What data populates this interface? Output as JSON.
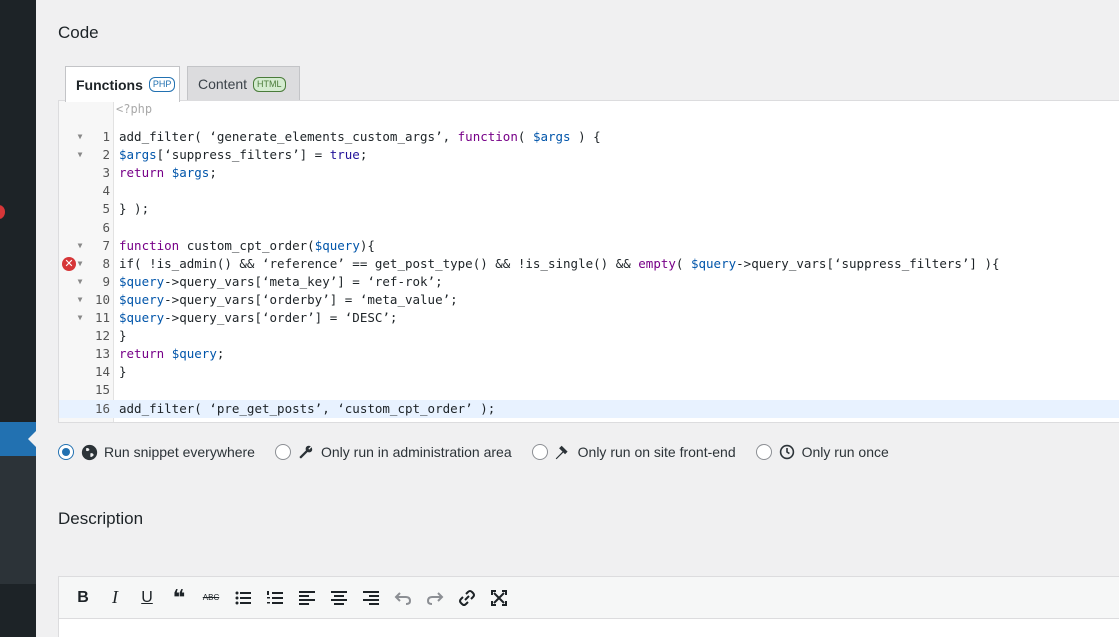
{
  "section_code_title": "Code",
  "tabs": [
    {
      "label": "Functions",
      "badge": "PHP"
    },
    {
      "label": "Content",
      "badge": "HTML"
    }
  ],
  "editor": {
    "php_open_tag": "<?php",
    "lines": [
      {
        "num": "1",
        "text": "add_filter( ‘generate_elements_custom_args’, function( $args ) {"
      },
      {
        "num": "2",
        "text": "$args[‘suppress_filters’] = true;"
      },
      {
        "num": "3",
        "text": "return $args;"
      },
      {
        "num": "4",
        "text": ""
      },
      {
        "num": "5",
        "text": "} );"
      },
      {
        "num": "6",
        "text": ""
      },
      {
        "num": "7",
        "text": "function custom_cpt_order($query){"
      },
      {
        "num": "8",
        "text": "if( !is_admin() && ‘reference’ == get_post_type() && !is_single() && empty( $query->query_vars[‘suppress_filters’] ){"
      },
      {
        "num": "9",
        "text": "$query->query_vars[‘meta_key’] = ‘ref-rok’;"
      },
      {
        "num": "10",
        "text": "$query->query_vars[‘orderby’] = ‘meta_value’;"
      },
      {
        "num": "11",
        "text": "$query->query_vars[‘order’] = ‘DESC’;"
      },
      {
        "num": "12",
        "text": "}"
      },
      {
        "num": "13",
        "text": "return $query;"
      },
      {
        "num": "14",
        "text": "}"
      },
      {
        "num": "15",
        "text": ""
      },
      {
        "num": "16",
        "text": "add_filter( ‘pre_get_posts’, ‘custom_cpt_order’ );"
      }
    ],
    "error_line": "8",
    "active_line": "16"
  },
  "scopes": [
    {
      "label": "Run snippet everywhere",
      "icon": "globe-icon",
      "selected": true
    },
    {
      "label": "Only run in administration area",
      "icon": "wrench-icon",
      "selected": false
    },
    {
      "label": "Only run on site front-end",
      "icon": "hammer-icon",
      "selected": false
    },
    {
      "label": "Only run once",
      "icon": "clock-icon",
      "selected": false
    }
  ],
  "section_description_title": "Description",
  "toolbar": {
    "bold": "B",
    "italic": "I",
    "underline": "U",
    "blockquote": "❝",
    "strikethrough": "ABC"
  },
  "colors": {
    "accent": "#2271b1",
    "error": "#d63638",
    "sidebar": "#1d2327"
  }
}
